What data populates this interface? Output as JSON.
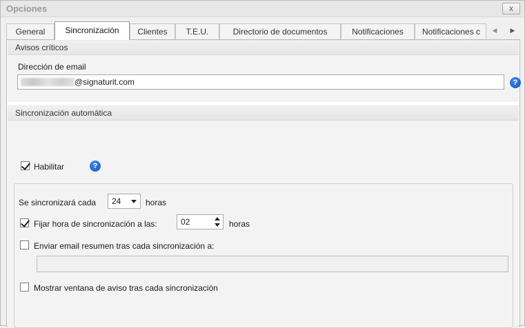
{
  "window": {
    "title": "Opciones",
    "close_glyph": "x"
  },
  "tabs": [
    {
      "label": "General"
    },
    {
      "label": "Sincronización",
      "active": true
    },
    {
      "label": "Clientes"
    },
    {
      "label": "T.E.U."
    },
    {
      "label": "Directorio de documentos"
    },
    {
      "label": "Notificaciones"
    },
    {
      "label": "Notificaciones c"
    }
  ],
  "tab_scroll": {
    "left_icon": "chevron-left-icon",
    "right_icon": "chevron-right-icon",
    "left_glyph": "◀",
    "right_glyph": "▶"
  },
  "avisos": {
    "header": "Avisos críticos",
    "email_label": "Dirección de email",
    "email_value": "@signaturit.com",
    "help_glyph": "?"
  },
  "sync": {
    "header": "Sincronización automática",
    "enable_label": "Habilitar",
    "enable_checked": true,
    "help_glyph": "?",
    "every_label": "Se sincronizará cada",
    "every_value": "24",
    "every_unit": "horas",
    "fix_time_label": "Fijar hora de sincronización a las:",
    "fix_time_checked": true,
    "fix_time_value": "02",
    "fix_time_unit": "horas",
    "email_summary_label": "Enviar email resumen tras cada sincronización a:",
    "email_summary_checked": false,
    "email_summary_value": "",
    "show_window_label": "Mostrar ventana de aviso tras cada sincronización",
    "show_window_checked": false
  },
  "colors": {
    "help_blue": "#1f6fdc",
    "window_bg": "#f0f0f0",
    "active_tab_bg": "#ffffff"
  }
}
